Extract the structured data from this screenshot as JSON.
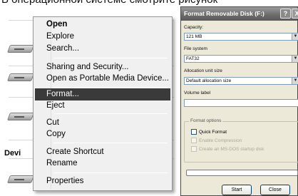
{
  "background": {
    "caption": "В операционной системе смотрите рисунок",
    "devices_label": "Devi"
  },
  "context_menu": {
    "items": [
      {
        "label": "Open",
        "bold": true
      },
      {
        "label": "Explore"
      },
      {
        "label": "Search..."
      },
      {
        "label": "Sharing and Security..."
      },
      {
        "label": "Open as Portable Media Device..."
      },
      {
        "label": "Format...",
        "selected": true
      },
      {
        "label": "Eject"
      },
      {
        "label": "Cut"
      },
      {
        "label": "Copy"
      },
      {
        "label": "Create Shortcut"
      },
      {
        "label": "Rename"
      },
      {
        "label": "Properties"
      }
    ]
  },
  "dialog": {
    "title": "Format Removable Disk (F:)",
    "help_button": "?",
    "close_button": "X",
    "capacity_label": "Capacity:",
    "capacity_value": "121 MB",
    "filesystem_label": "File system",
    "filesystem_value": "FAT32",
    "allocation_label": "Allocation unit size",
    "allocation_value": "Default allocation size",
    "volume_label": "Volume label",
    "volume_value": "",
    "format_options_label": "Format options",
    "quick_format": "Quick Format",
    "enable_compression": "Enable Compression",
    "create_msdos": "Create an MS-DOS startup disk",
    "progress": 0,
    "start_button": "Start",
    "close_btn_label": "Close"
  },
  "colors": {
    "menu_selected": "#3a3a3a",
    "dialog_bg": "#ece9d8"
  }
}
